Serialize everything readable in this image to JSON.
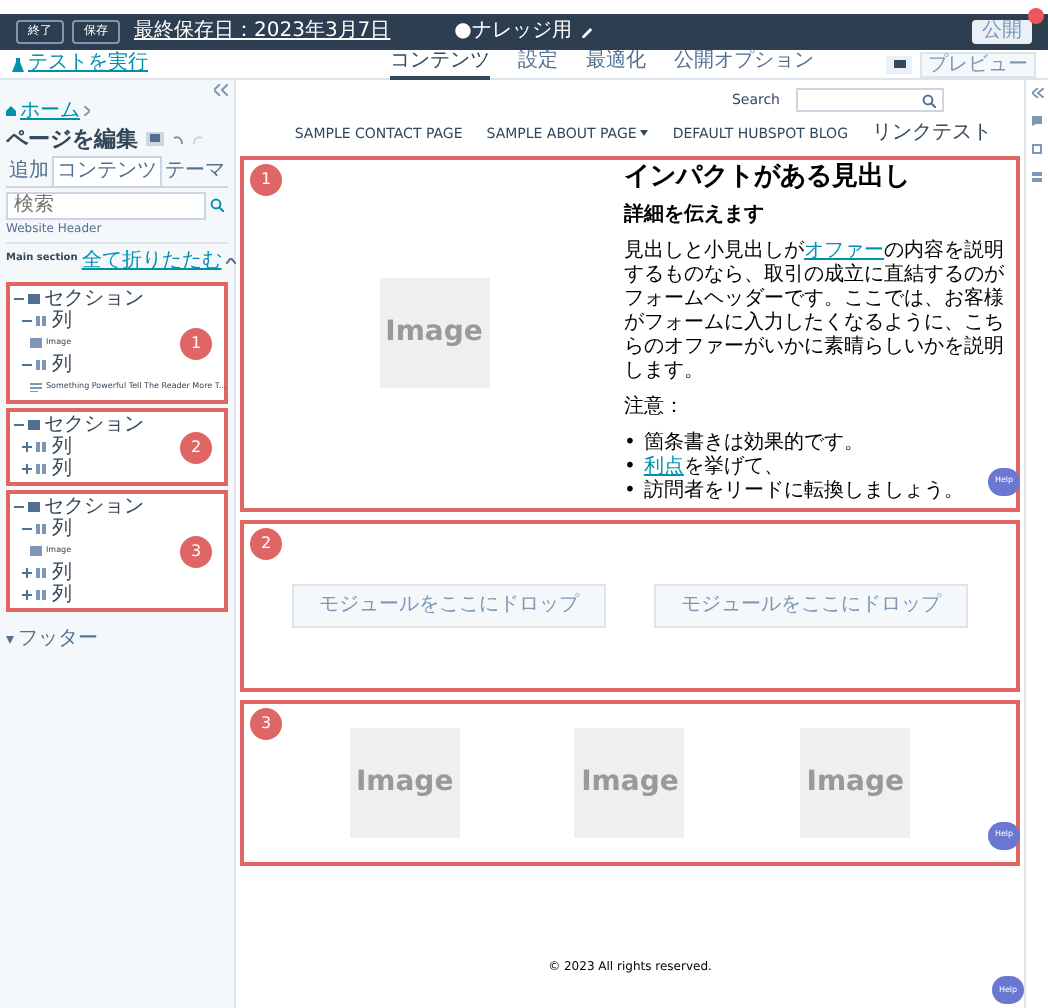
{
  "top_bar": {
    "buttons": [
      "終了",
      "保存"
    ],
    "last_saved": "最終保存日：2023年3月7日",
    "page_title": "●ナレッジ用",
    "publish_button": "公開",
    "publish_alert": true
  },
  "sub_bar": {
    "test_link": "テストを実行",
    "tabs": [
      {
        "label": "コンテンツ",
        "selected": true
      },
      {
        "label": "設定",
        "selected": false
      },
      {
        "label": "最適化",
        "selected": false
      },
      {
        "label": "公開オプション",
        "selected": false
      }
    ],
    "preview_button": "プレビュー"
  },
  "sidebar": {
    "breadcrumb": "ホーム",
    "title": "ページを編集",
    "tabs": [
      {
        "label": "追加",
        "selected": false
      },
      {
        "label": "コンテンツ",
        "selected": true
      },
      {
        "label": "テーマ",
        "selected": false
      }
    ],
    "search": {
      "placeholder": "検索"
    },
    "header_item": "Website Header",
    "main_section": {
      "label": "Main section",
      "collapse_all": "全て折りたたむ"
    },
    "groups": [
      {
        "badge": "1",
        "tree": [
          {
            "kind": "section",
            "label": "セクション",
            "expanded": true,
            "children": [
              {
                "kind": "column",
                "label": "列",
                "expanded": true,
                "children": [
                  {
                    "kind": "image",
                    "label": "Image"
                  }
                ]
              },
              {
                "kind": "column",
                "label": "列",
                "expanded": true,
                "children": [
                  {
                    "kind": "richtext",
                    "label": "Something Powerful Tell The Reader More T..."
                  }
                ]
              }
            ]
          }
        ]
      },
      {
        "badge": "2",
        "tree": [
          {
            "kind": "section",
            "label": "セクション",
            "expanded": true,
            "children": [
              {
                "kind": "column",
                "label": "列",
                "expanded": false
              },
              {
                "kind": "column",
                "label": "列",
                "expanded": false
              }
            ]
          }
        ]
      },
      {
        "badge": "3",
        "tree": [
          {
            "kind": "section",
            "label": "セクション",
            "expanded": true,
            "children": [
              {
                "kind": "column",
                "label": "列",
                "expanded": true,
                "children": [
                  {
                    "kind": "image",
                    "label": "Image"
                  }
                ]
              },
              {
                "kind": "column",
                "label": "列",
                "expanded": false
              },
              {
                "kind": "column",
                "label": "列",
                "expanded": false
              }
            ]
          }
        ]
      }
    ],
    "footer_item": "フッター"
  },
  "page": {
    "search_label": "Search",
    "nav": [
      {
        "label": "SAMPLE CONTACT PAGE",
        "dropdown": false
      },
      {
        "label": "SAMPLE ABOUT PAGE",
        "dropdown": true
      },
      {
        "label": "DEFAULT HUBSPOT BLOG",
        "dropdown": false
      },
      {
        "label": "リンクテスト",
        "dropdown": false
      }
    ],
    "sections": [
      {
        "badge": "1",
        "kind": "hero",
        "image": "Image",
        "heading": "インパクトがある見出し",
        "subheading": "詳細を伝えます",
        "paragraph": [
          {
            "text": "見出しと小見出しが",
            "link": false
          },
          {
            "text": "オファー",
            "link": true
          },
          {
            "text": "の内容を説明するものなら、取引の成立に直結するのがフォームヘッダーです。ここでは、お客様がフォームに入力したくなるように、こちらのオファーがいかに素晴らしいかを説明します。",
            "link": false
          }
        ],
        "note": "注意：",
        "bullets": [
          {
            "marker": "•",
            "parts": [
              {
                "text": "箇条書きは効果的です。",
                "link": false
              }
            ]
          },
          {
            "marker": "•",
            "parts": [
              {
                "text": "利点",
                "link": true
              },
              {
                "text": "を挙げて、",
                "link": false
              }
            ]
          },
          {
            "marker": "•",
            "parts": [
              {
                "text": "訪問者をリードに転換しましょう。",
                "link": false
              }
            ]
          }
        ],
        "help": "Help"
      },
      {
        "badge": "2",
        "kind": "dropzones",
        "zones": [
          "モジュールをここにドロップ",
          "モジュールをここにドロップ"
        ]
      },
      {
        "badge": "3",
        "kind": "images",
        "images": [
          "Image",
          "Image",
          "Image"
        ],
        "help": "Help"
      }
    ],
    "footer": "© 2023 All rights reserved.",
    "help": "Help"
  }
}
